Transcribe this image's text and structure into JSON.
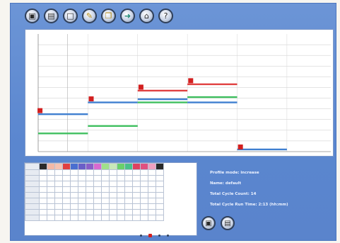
{
  "toolbar": {
    "buttons": [
      {
        "name": "open-file",
        "icon": "page-icon",
        "glyph": "▣"
      },
      {
        "name": "save-file",
        "icon": "pages-icon",
        "glyph": "▤"
      },
      {
        "name": "new-file",
        "icon": "blank-page-icon",
        "glyph": "□"
      },
      {
        "name": "edit-profile",
        "icon": "pencil-page-icon",
        "glyph": "✎"
      },
      {
        "name": "copy-profile",
        "icon": "copy-page-icon",
        "glyph": "❐"
      },
      {
        "name": "export",
        "icon": "page-arrow-icon",
        "glyph": "➜"
      },
      {
        "name": "home",
        "icon": "home-icon",
        "glyph": "⌂"
      },
      {
        "name": "help",
        "icon": "help-icon",
        "glyph": "?"
      }
    ]
  },
  "chart_data": {
    "type": "line",
    "xlim": [
      0,
      10
    ],
    "ylim": [
      0,
      11
    ],
    "segments": [
      {
        "color": "#3f7fd0",
        "x": [
          0,
          1.7
        ],
        "y": [
          3.5,
          3.5
        ]
      },
      {
        "color": "#3fbf5f",
        "x": [
          0,
          1.7
        ],
        "y": [
          1.7,
          1.7
        ]
      },
      {
        "color": "#3f7fd0",
        "x": [
          1.7,
          3.4
        ],
        "y": [
          4.6,
          4.6
        ]
      },
      {
        "color": "#3fbf5f",
        "x": [
          1.7,
          3.4
        ],
        "y": [
          2.4,
          2.4
        ]
      },
      {
        "color": "#e04040",
        "x": [
          3.4,
          5.1
        ],
        "y": [
          5.7,
          5.7
        ]
      },
      {
        "color": "#3f7fd0",
        "x": [
          3.4,
          5.1
        ],
        "y": [
          4.9,
          4.9
        ]
      },
      {
        "color": "#3fbf5f",
        "x": [
          3.4,
          5.1
        ],
        "y": [
          4.6,
          4.6
        ]
      },
      {
        "color": "#e04040",
        "x": [
          5.1,
          6.8
        ],
        "y": [
          6.3,
          6.3
        ]
      },
      {
        "color": "#3fbf5f",
        "x": [
          5.1,
          6.8
        ],
        "y": [
          5.1,
          5.1
        ]
      },
      {
        "color": "#3f7fd0",
        "x": [
          5.1,
          6.8
        ],
        "y": [
          4.6,
          4.6
        ]
      },
      {
        "color": "#3f7fd0",
        "x": [
          6.8,
          8.5
        ],
        "y": [
          0.2,
          0.2
        ]
      }
    ],
    "markers": [
      {
        "x": 0.05,
        "y": 3.8
      },
      {
        "x": 1.8,
        "y": 4.9
      },
      {
        "x": 3.5,
        "y": 6.0
      },
      {
        "x": 5.2,
        "y": 6.6
      },
      {
        "x": 6.9,
        "y": 0.4
      }
    ]
  },
  "table": {
    "swatches": [
      "#2a2a2a",
      "#f4b9a6",
      "#f6c3b2",
      "#e04040",
      "#4a6fd0",
      "#6a5fc8",
      "#8a5fc8",
      "#d86ad0",
      "#a0e08a",
      "#c8e8b8",
      "#6ad06a",
      "#4ac08a",
      "#e04060",
      "#e05080",
      "#f0a0c0"
    ],
    "rows": 10,
    "cols": 17
  },
  "info": {
    "profile_mode": "Profile mode: increase",
    "name": "Name: default",
    "total_cycle_count": "Total Cycle Count: 14",
    "total_cycle_run_time": "Total Cycle Run Time: 2:13 (hh:mm)"
  },
  "pager": {
    "pages": 4,
    "active": 1
  }
}
